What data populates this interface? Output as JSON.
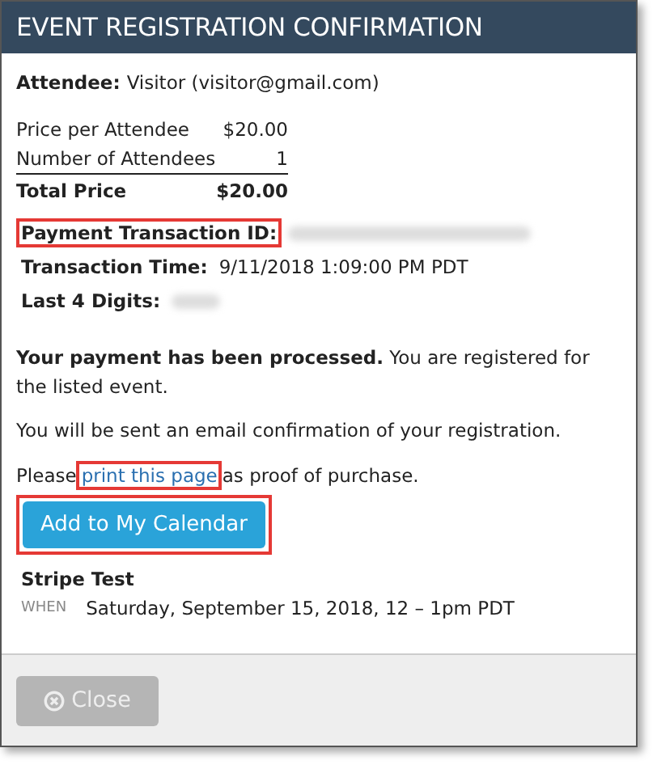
{
  "dialog": {
    "title": "EVENT REGISTRATION CONFIRMATION"
  },
  "attendee": {
    "label": "Attendee:",
    "value": "Visitor (visitor@gmail.com)"
  },
  "price_rows": [
    {
      "label": "Price per Attendee",
      "value": "$20.00",
      "kind": "item"
    },
    {
      "label": "Number of Attendees",
      "value": "1",
      "kind": "item"
    },
    {
      "label": "Total Price",
      "value": "$20.00",
      "kind": "total"
    }
  ],
  "details": [
    {
      "label": "Payment Transaction ID:",
      "value_blurred": true,
      "highlighted": true
    },
    {
      "label": "Transaction Time:",
      "value": "9/11/2018 1:09:00 PM PDT",
      "highlighted": false
    },
    {
      "label": "Last 4 Digits:",
      "value_blurred": true,
      "highlighted": false
    }
  ],
  "message": "**Your payment has been processed.** You are registered for the listed event.",
  "email_note": "You will be sent an email confirmation of your registration.",
  "print_note": {
    "before": "Please",
    "link": "print this page",
    "after": "as proof of purchase.",
    "highlighted": true
  },
  "calendar_button": {
    "label": "Add to My Calendar",
    "highlighted": true
  },
  "event": {
    "name": "Stripe Test",
    "when_label": "WHEN",
    "when": "Saturday, September 15, 2018, 12 – 1pm PDT"
  },
  "footer": {
    "close_button": {
      "label": "Close",
      "disabled": true
    }
  }
}
